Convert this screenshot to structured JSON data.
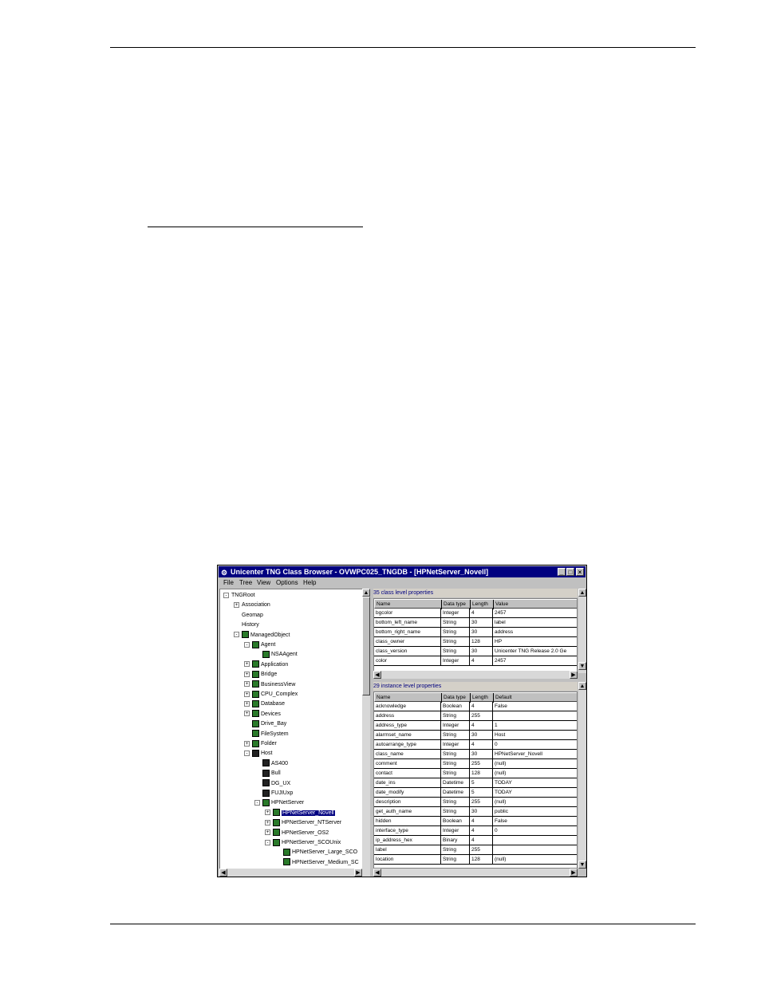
{
  "window": {
    "title": "Unicenter TNG Class Browser - OVWPC025_TNGDB - [HPNetServer_Novell]",
    "buttons": {
      "minimize": "_",
      "maximize": "□",
      "close": "×"
    },
    "menu": [
      "File",
      "Tree",
      "View",
      "Options",
      "Help"
    ]
  },
  "tree": [
    {
      "label": "TNGRoot",
      "icon": "none",
      "expand": "-"
    },
    {
      "label": "Association",
      "icon": "none",
      "expand": "+"
    },
    {
      "label": "Geomap",
      "icon": "none",
      "expand": ""
    },
    {
      "label": "History",
      "icon": "none",
      "expand": ""
    },
    {
      "label": "ManagedObject",
      "icon": "managed-object-icon",
      "expand": "-"
    },
    {
      "label": "Agent",
      "icon": "agent-icon",
      "expand": "-"
    },
    {
      "label": "NSAAgent",
      "icon": "agent-icon",
      "expand": ""
    },
    {
      "label": "Application",
      "icon": "application-icon",
      "expand": "+"
    },
    {
      "label": "Bridge",
      "icon": "bridge-icon",
      "expand": "+"
    },
    {
      "label": "BusinessView",
      "icon": "business-view-icon",
      "expand": "+"
    },
    {
      "label": "CPU_Complex",
      "icon": "cpu-icon",
      "expand": "+"
    },
    {
      "label": "Database",
      "icon": "database-icon",
      "expand": "+"
    },
    {
      "label": "Devices",
      "icon": "devices-icon",
      "expand": "+"
    },
    {
      "label": "Drive_Bay",
      "icon": "drive-bay-icon",
      "expand": ""
    },
    {
      "label": "FileSystem",
      "icon": "filesystem-icon",
      "expand": ""
    },
    {
      "label": "Folder",
      "icon": "folder-icon",
      "expand": "+"
    },
    {
      "label": "Host",
      "icon": "host-icon",
      "expand": "-"
    },
    {
      "label": "AS400",
      "icon": "host-icon",
      "expand": ""
    },
    {
      "label": "Bull",
      "icon": "host-icon",
      "expand": ""
    },
    {
      "label": "DG_UX",
      "icon": "host-icon",
      "expand": ""
    },
    {
      "label": "FUJIUxp",
      "icon": "host-icon",
      "expand": ""
    },
    {
      "label": "HPNetServer",
      "icon": "server-icon",
      "expand": "-"
    },
    {
      "label": "HPNetServer_Novell",
      "icon": "server-icon",
      "expand": "+",
      "selected": true
    },
    {
      "label": "HPNetServer_NTServer",
      "icon": "server-icon",
      "expand": "+"
    },
    {
      "label": "HPNetServer_OS2",
      "icon": "server-icon",
      "expand": "+"
    },
    {
      "label": "HPNetServer_SCOUnix",
      "icon": "server-icon",
      "expand": "-"
    },
    {
      "label": "HPNetServer_Large_SCO",
      "icon": "server-icon",
      "expand": ""
    },
    {
      "label": "HPNetServer_Medium_SC",
      "icon": "server-icon",
      "expand": ""
    }
  ],
  "class_props": {
    "title": "35 class level properties",
    "columns": [
      "Name",
      "Data type",
      "Length",
      "Value"
    ],
    "rows": [
      [
        "bgcolor",
        "Integer",
        "4",
        "2457"
      ],
      [
        "bottom_left_name",
        "String",
        "30",
        "label"
      ],
      [
        "bottom_right_name",
        "String",
        "30",
        "address"
      ],
      [
        "class_owner",
        "String",
        "128",
        "HP"
      ],
      [
        "class_version",
        "String",
        "30",
        "Unicenter TNG Release 2.0 Ge"
      ],
      [
        "color",
        "Integer",
        "4",
        "2457"
      ]
    ]
  },
  "instance_props": {
    "title": "29 instance level properties",
    "columns": [
      "Name",
      "Data type",
      "Length",
      "Default"
    ],
    "rows": [
      [
        "acknowledge",
        "Boolean",
        "4",
        "False"
      ],
      [
        "address",
        "String",
        "255",
        ""
      ],
      [
        "address_type",
        "Integer",
        "4",
        "1"
      ],
      [
        "alarmset_name",
        "String",
        "30",
        "Host"
      ],
      [
        "autoarrange_type",
        "Integer",
        "4",
        "0"
      ],
      [
        "class_name",
        "String",
        "30",
        "HPNetServer_Novell"
      ],
      [
        "comment",
        "String",
        "255",
        "(null)"
      ],
      [
        "contact",
        "String",
        "128",
        "(null)"
      ],
      [
        "date_ins",
        "Datetime",
        "5",
        "TODAY"
      ],
      [
        "date_modify",
        "Datetime",
        "5",
        "TODAY"
      ],
      [
        "description",
        "String",
        "255",
        "(null)"
      ],
      [
        "get_auth_name",
        "String",
        "30",
        "public"
      ],
      [
        "hidden",
        "Boolean",
        "4",
        "False"
      ],
      [
        "interface_type",
        "Integer",
        "4",
        "0"
      ],
      [
        "ip_address_hex",
        "Binary",
        "4",
        ""
      ],
      [
        "label",
        "String",
        "255",
        ""
      ],
      [
        "location",
        "String",
        "128",
        "(null)"
      ]
    ]
  }
}
